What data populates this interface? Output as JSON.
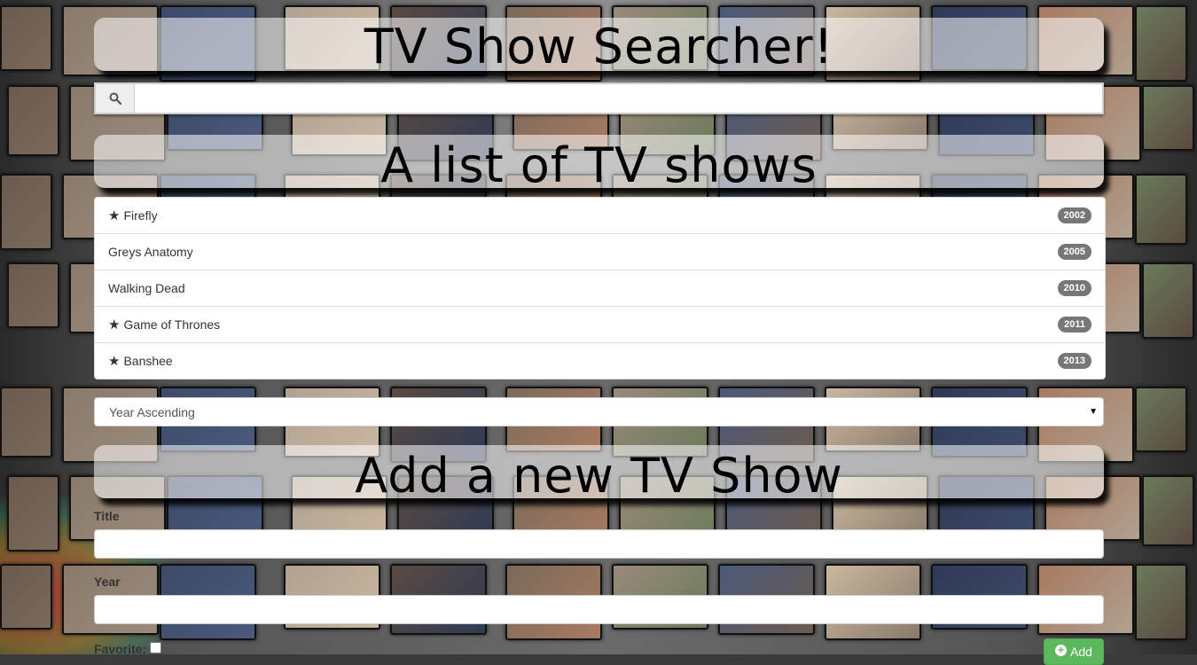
{
  "header": {
    "title": "TV Show Searcher!"
  },
  "search": {
    "placeholder": "",
    "value": "",
    "icon": "search-icon"
  },
  "list_section": {
    "heading": "A list of TV shows",
    "shows": [
      {
        "title": "Firefly",
        "year": "2002",
        "favorite": true
      },
      {
        "title": "Greys Anatomy",
        "year": "2005",
        "favorite": false
      },
      {
        "title": "Walking Dead",
        "year": "2010",
        "favorite": false
      },
      {
        "title": "Game of Thrones",
        "year": "2011",
        "favorite": true
      },
      {
        "title": "Banshee",
        "year": "2013",
        "favorite": true
      }
    ],
    "sort": {
      "selected": "Year Ascending"
    }
  },
  "add_section": {
    "heading": "Add a new TV Show",
    "title_label": "Title",
    "year_label": "Year",
    "favorite_label": "Favorite:",
    "add_button": "Add"
  },
  "colors": {
    "badge": "#777777",
    "add_button": "#5cb85c",
    "heading_bg": "rgba(255,255,255,0.55)"
  }
}
